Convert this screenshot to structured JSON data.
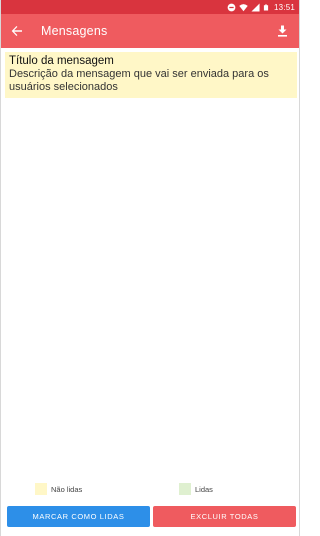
{
  "status_bar": {
    "time": "13:51",
    "icons": [
      "minus-circle-icon",
      "wifi-icon",
      "signal-icon",
      "battery-icon"
    ]
  },
  "app_bar": {
    "title": "Mensagens",
    "back_icon": "arrow-left-icon",
    "action_icon": "download-icon",
    "color": "#ef5b5f",
    "status_color": "#d9343e"
  },
  "messages": [
    {
      "title": "Título da mensagem",
      "description": "Descrição da mensagem que vai ser enviada para os usuários selecionados",
      "status": "unread",
      "color": "#fff7c7"
    }
  ],
  "legend": {
    "unread": {
      "label": "Não lidas",
      "color": "#fff7c7"
    },
    "read": {
      "label": "Lidas",
      "color": "#dff0d0"
    }
  },
  "actions": {
    "mark_read_label": "MARCAR COMO LIDAS",
    "mark_read_color": "#2d8fe8",
    "delete_all_label": "EXCLUIR TODAS",
    "delete_all_color": "#ef5b5f"
  }
}
